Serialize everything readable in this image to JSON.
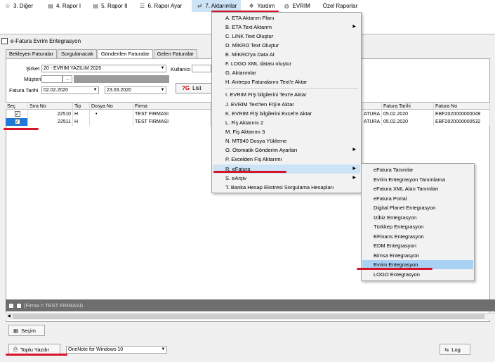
{
  "menubar": [
    {
      "label": "3.  Diğer",
      "icon": "user-icon"
    },
    {
      "label": "4.  Rapor I",
      "icon": "chart-icon"
    },
    {
      "label": "5.  Rapor II",
      "icon": "chart-icon"
    },
    {
      "label": "6.  Rapor Ayar",
      "icon": "doc-icon"
    },
    {
      "label": "7.  Aktarımlar",
      "icon": "transfer-icon"
    },
    {
      "label": "Yardım",
      "icon": "help-icon"
    },
    {
      "label": "EVRIM",
      "icon": "globe-icon"
    },
    {
      "label": "Özel Raporlar",
      "icon": ""
    }
  ],
  "window": {
    "title": "e-Fatura Evrim Entegrasyon",
    "tabs": [
      "Bekleyen Faturalar",
      "Sorgulanacak",
      "Gönderilen Faturalar",
      "Gelen Faturalar"
    ],
    "filters": {
      "sirket_label": "Şirket",
      "sirket_value": "20 - EVRIM YAZILIM 2020",
      "kullanici_label": "Kullanıcı",
      "musteri_label": "Müşteri",
      "fatura_tarihi_label": "Fatura Tarihi",
      "date_from": "02.02.2020",
      "date_to": "23.03.2020",
      "list_button": "Listele",
      "list_button_short": "List"
    },
    "table": {
      "headers": [
        "Seç",
        "Sıra No",
        "Tip",
        "Dosya No",
        "Firma",
        "",
        "Fatura Tarihi",
        "Fatura No"
      ],
      "rows": [
        {
          "sec": "✓",
          "sira": "22510",
          "tip": "H",
          "dosya": "•",
          "firma": "TEST FIRMASI",
          "extra": "ATURA",
          "tarih": "05.02.2020",
          "no": "EBF2020000000049"
        },
        {
          "sec": "✓",
          "sira": "22511",
          "tip": "H",
          "dosya": "",
          "firma": "TEST FIRMASI",
          "extra": "ATURA",
          "tarih": "05.02.2020",
          "no": "EBF2020000000532"
        }
      ]
    },
    "footer_filter": "(Firma = TEST FIRMASI)",
    "sec_button": "Seçim",
    "toplu_button": "Toplu Yazdır",
    "printer_value": "OneNote for Windows 10",
    "log_button": "Log"
  },
  "aktarimlar_menu": [
    {
      "label": "A.  ETA Aktarım Planı",
      "sub": false
    },
    {
      "label": "B.  ETA Text Aktarım",
      "sub": true
    },
    {
      "label": "C.  LINK Text Oluştur",
      "sub": false
    },
    {
      "label": "D.  MİKRO Text Oluştur",
      "sub": false
    },
    {
      "label": "E.  MİKRO'ya  Data  At",
      "sub": false
    },
    {
      "label": "F.  LOGO XML datası oluştur",
      "sub": false
    },
    {
      "label": "G.  Aktarımlar",
      "sub": false
    },
    {
      "label": "H.  Antrepo Faturalarını Text'e Aktar",
      "sub": false
    },
    {
      "label": "I.  EVRIM FIŞ bilgilerini Text'e Aktar",
      "sub": false
    },
    {
      "label": "J.  EVRIM Text'ten FIŞ'e Aktar",
      "sub": false
    },
    {
      "label": "K.  EVRIM FİŞ bilgilerini Excel'e Aktar",
      "sub": false
    },
    {
      "label": "L.  Fiş Aktarımı 2",
      "sub": false
    },
    {
      "label": "M.  Fiş Aktarımı 3",
      "sub": false
    },
    {
      "label": "N.  MT940 Dosya Yükleme",
      "sub": false
    },
    {
      "label": "O. Otomatik Gönderim Ayarları",
      "sub": true
    },
    {
      "label": "P.  Excelden Fiş Aktarımı",
      "sub": false
    },
    {
      "label": "R. eFatura",
      "sub": true
    },
    {
      "label": "S.  eArşiv",
      "sub": true
    },
    {
      "label": "T.  Banka Hesap Ekstresi Sorgulama Hesapları",
      "sub": false
    }
  ],
  "efatura_submenu": [
    "eFatura Tanımlar",
    "Evrim Entegrasyon Tanımlama",
    "eFatura XML Alan Tanımları",
    "eFatura Portal",
    "Digital Planet Entegrasyon",
    "Izibiz Entegrasyon",
    "Türkkep Entegrasyon",
    "EFinans Entegrasyon",
    "EDM Entegrasyon",
    "Bimsa Entegrasyon",
    "Evrim Entegrasyon",
    "LOGO Entegrasyon"
  ],
  "colors": {
    "highlight": "#cde4f7",
    "annotation": "#d6152b",
    "selection": "#1e78d7"
  }
}
